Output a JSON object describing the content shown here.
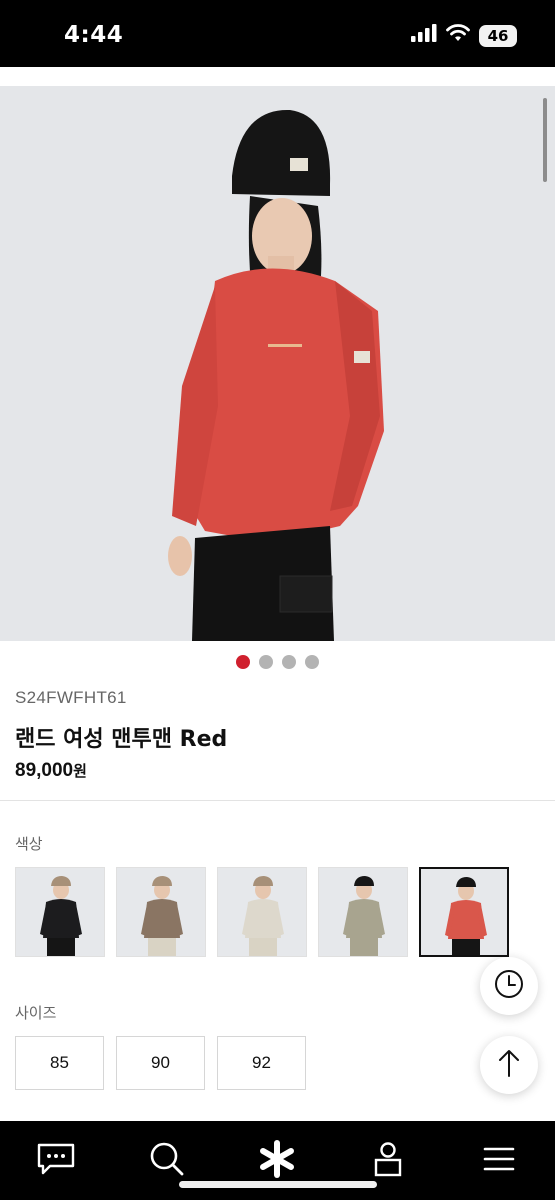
{
  "status_bar": {
    "time": "4:44",
    "battery": "46",
    "icons": [
      "cellular-signal-icon",
      "wifi-icon",
      "battery-icon"
    ]
  },
  "hero": {
    "image": "model-wearing-red-sweatshirt-black-beanie",
    "slide_count": 4,
    "active_slide": 1
  },
  "product": {
    "code": "S24FWFHT61",
    "name": "랜드 여성 맨투맨 Red",
    "price": "89,000",
    "currency": "원"
  },
  "colors": {
    "label": "색상",
    "options": [
      {
        "color": "#1c1c1e",
        "selected": false
      },
      {
        "color": "#8a7563",
        "selected": false
      },
      {
        "color": "#ddd8cc",
        "selected": false
      },
      {
        "color": "#a8a48f",
        "selected": false
      },
      {
        "color": "#d9574b",
        "selected": true
      }
    ]
  },
  "sizes": {
    "label": "사이즈",
    "options": [
      "85",
      "90",
      "92"
    ]
  },
  "floating": [
    "recent-history-icon",
    "scroll-to-top-icon"
  ],
  "bottom_nav": {
    "items": [
      "chat-icon",
      "search-icon",
      "brand-asterisk-icon",
      "my-page-icon",
      "menu-icon"
    ]
  },
  "accent": "#d0202e"
}
